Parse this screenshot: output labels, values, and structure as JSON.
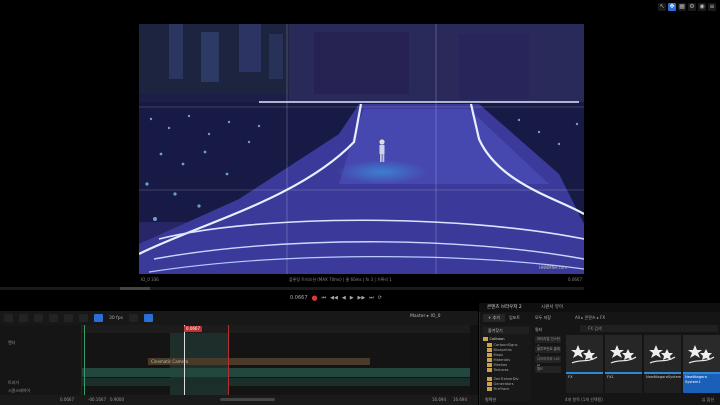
{
  "top_toolbar": {
    "icons": [
      "cursor-icon",
      "move-icon",
      "grid-icon",
      "gear-icon",
      "camera-icon",
      "settings-icon"
    ]
  },
  "viewport": {
    "footer_left": "IO_0 336",
    "footer_center": "플롯팅 트리오션 (MAX 70ms) | 줄 60ms | fx 3 | 기록리 1",
    "footer_right": "0.0667",
    "watermark": "HNNMNH.com"
  },
  "playback": {
    "time": "0.0667",
    "controls": [
      "⏺",
      "⏮",
      "⏪",
      "◀",
      "▶",
      "⏩",
      "⏭",
      "🔁"
    ]
  },
  "sequencer": {
    "toolbar": {
      "fps": "30 fps",
      "master": "Master ▸ IO_0"
    },
    "tracks": [
      "",
      "",
      "",
      "",
      "",
      "",
      "",
      "",
      ""
    ],
    "track_labels": {
      "row1": "",
      "row2": "렌더",
      "row7": "트리거",
      "row9": "시퀀스레이어"
    },
    "playhead": "0.0667",
    "clip_label": "Cinematic Camera",
    "bottom": {
      "start": "0.0667",
      "mid1": "-00.1667",
      "mid2": "0.9000",
      "end1": "16.694",
      "end2": "16.694"
    }
  },
  "content_browser": {
    "tab_main": "콘텐츠 브라우저 2",
    "tab_second": "시퀀서 뷰어",
    "add": "+ 추가",
    "import": "임포트",
    "save_all": "모두 저장",
    "path": "All ▸ 콘텐츠 ▸ FX",
    "favorites": "즐겨찾기",
    "root": "Collision",
    "folders": [
      "CartoonSigns",
      "Blueprints",
      "Maps",
      "Materials",
      "Meshes",
      "Textures",
      "ZenTrainerDiv",
      "Generators",
      "FireTrack"
    ],
    "filter_head": "필터",
    "filters": [
      "머티리얼 인스턴스",
      "블루프린트 클래스",
      "나이아가라 시스템",
      "월드"
    ],
    "search_placeholder": "FX 검색",
    "assets": [
      {
        "name": "FX",
        "selected": false
      },
      {
        "name": "FX1",
        "selected": false
      },
      {
        "name": "NewNiagaraSystem",
        "selected": false
      },
      {
        "name": "NewNiagara System1",
        "selected": true
      }
    ],
    "status": "4개 항목 (1개 선택됨)",
    "view": "뷰 옵션",
    "collections": "컬렉션"
  }
}
